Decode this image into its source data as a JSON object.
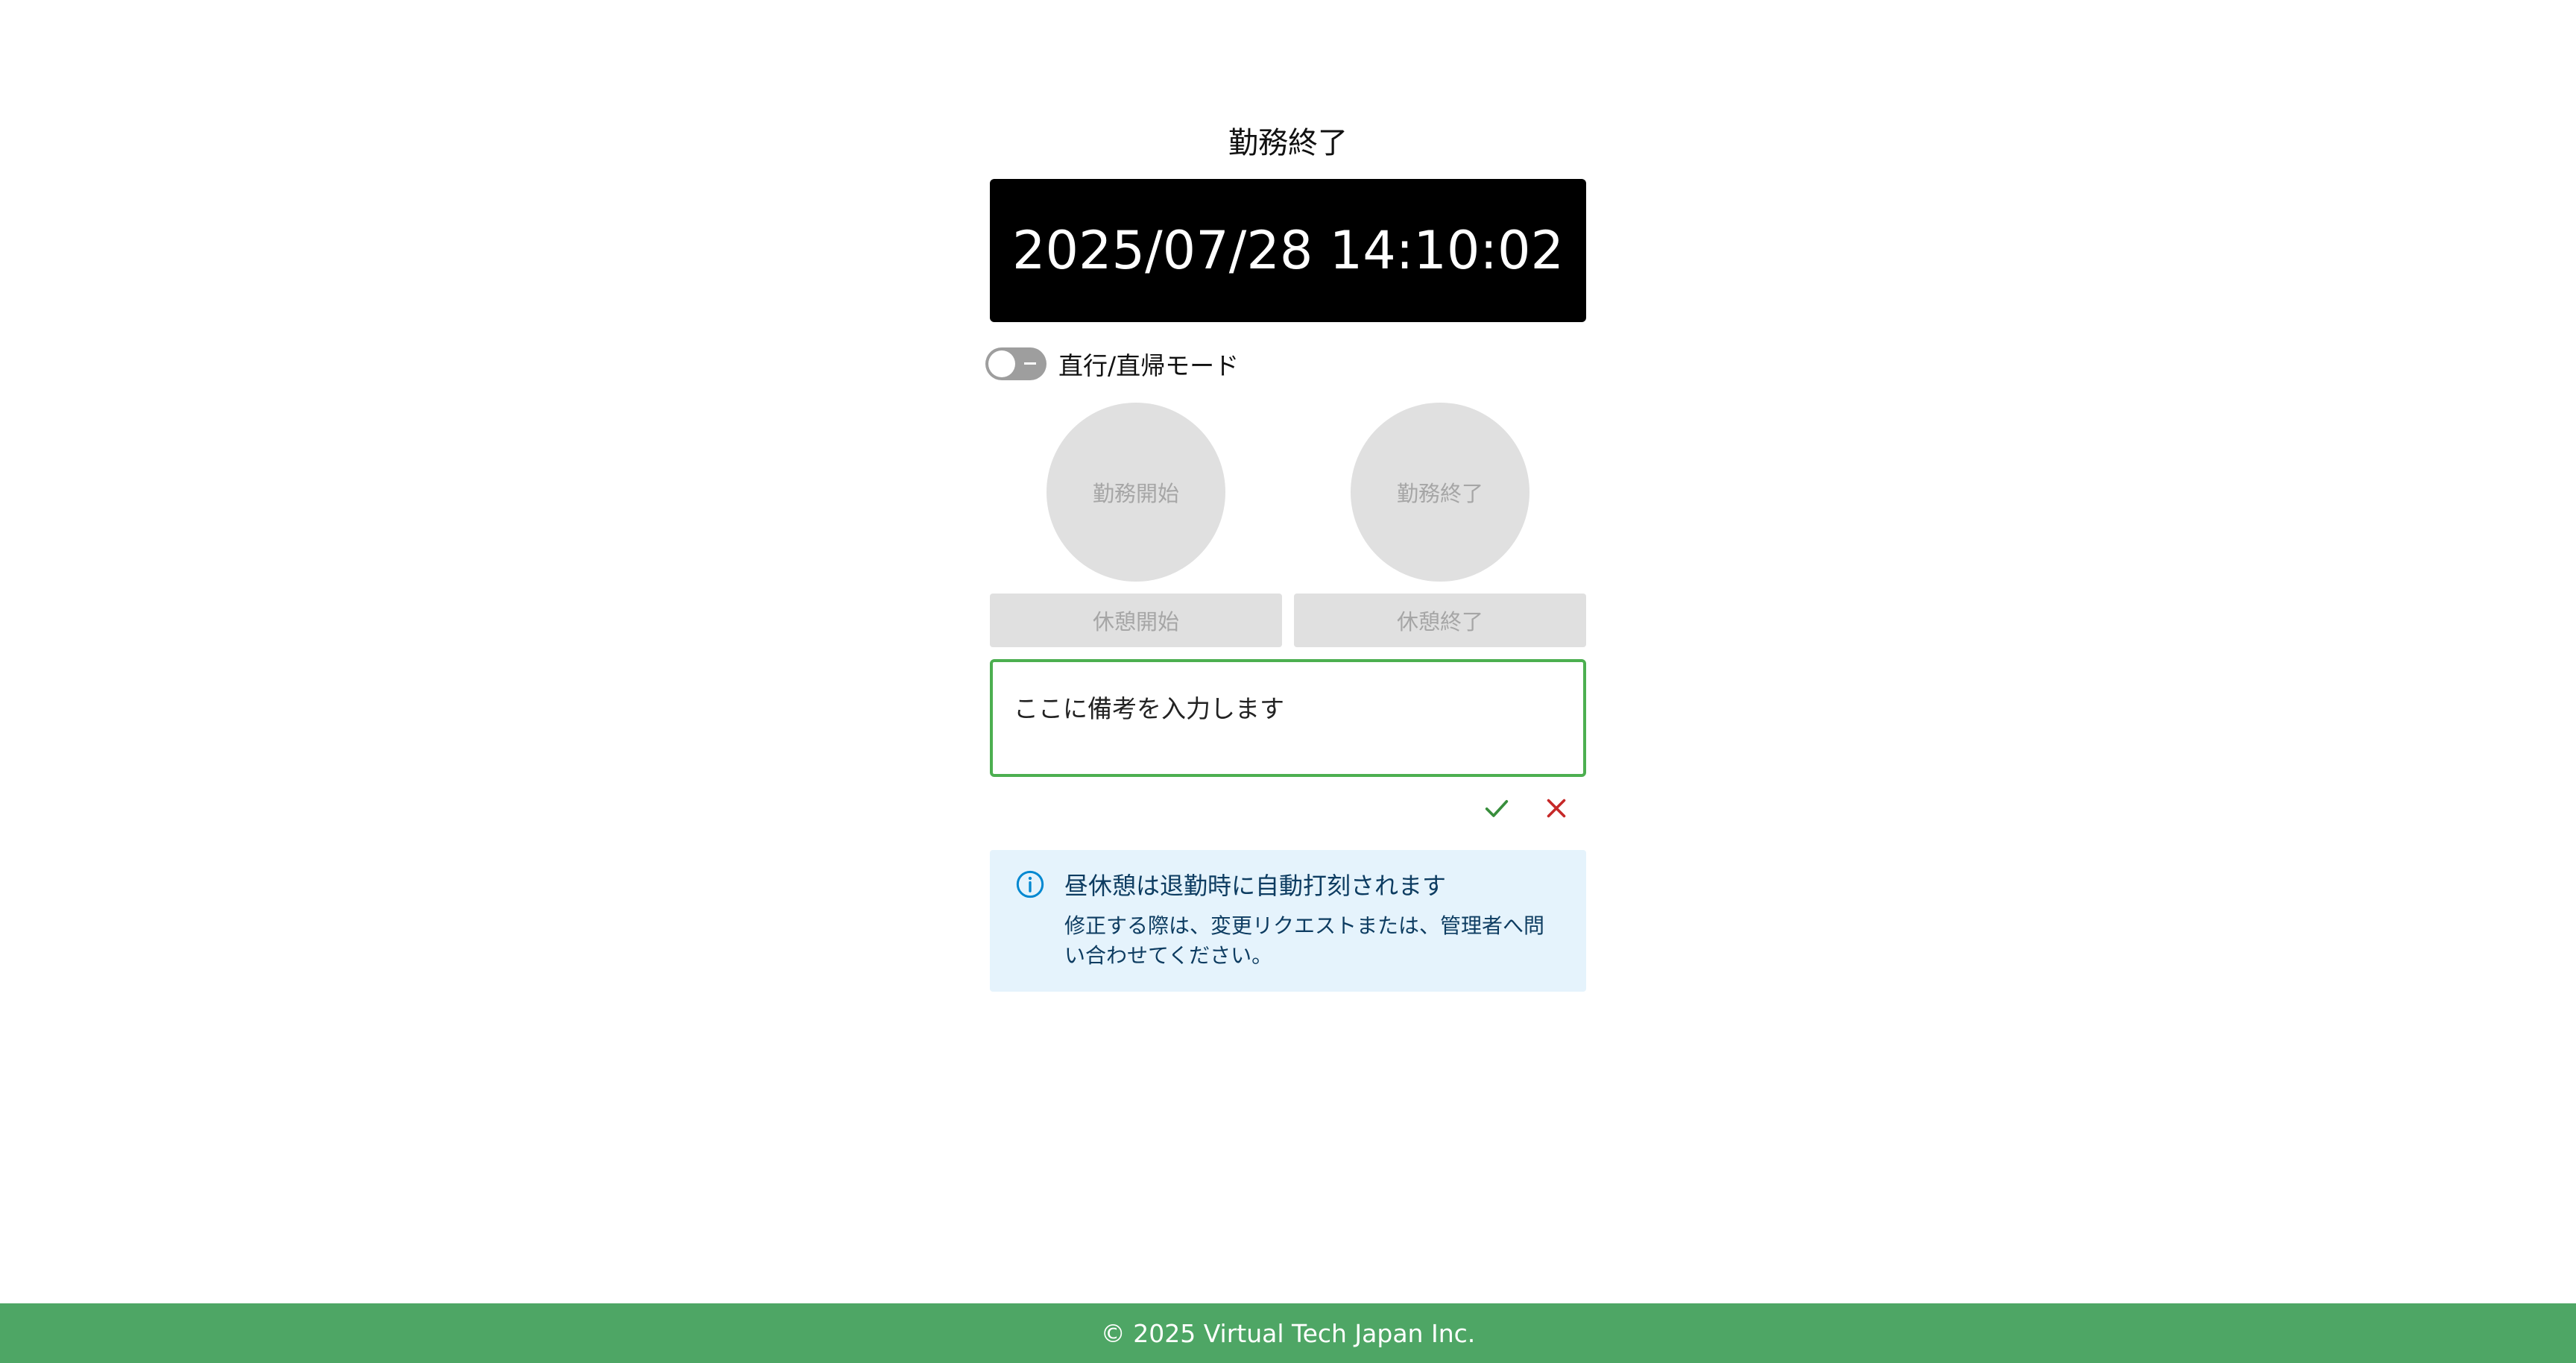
{
  "header": {
    "status_title": "勤務終了"
  },
  "clock": {
    "datetime": "2025/07/28 14:10:02"
  },
  "mode_toggle": {
    "label": "直行/直帰モード",
    "enabled": false
  },
  "actions": {
    "clock_in_label": "勤務開始",
    "clock_out_label": "勤務終了",
    "break_start_label": "休憩開始",
    "break_end_label": "休憩終了"
  },
  "note": {
    "value": "ここに備考を入力します",
    "placeholder": ""
  },
  "note_actions": {
    "confirm_icon": "check-icon",
    "cancel_icon": "close-icon",
    "confirm_color": "#388e3c",
    "cancel_color": "#c62828"
  },
  "info": {
    "title": "昼休憩は退勤時に自動打刻されます",
    "body": "修正する際は、変更リクエストまたは、管理者へ問い合わせてください。"
  },
  "footer": {
    "copyright": "© 2025 Virtual Tech Japan Inc."
  },
  "colors": {
    "accent": "#4caf50",
    "footer_bg": "#4ea665",
    "info_bg": "#e5f3fc",
    "info_text": "#0d3c61",
    "disabled_bg": "#e0e0e0"
  }
}
